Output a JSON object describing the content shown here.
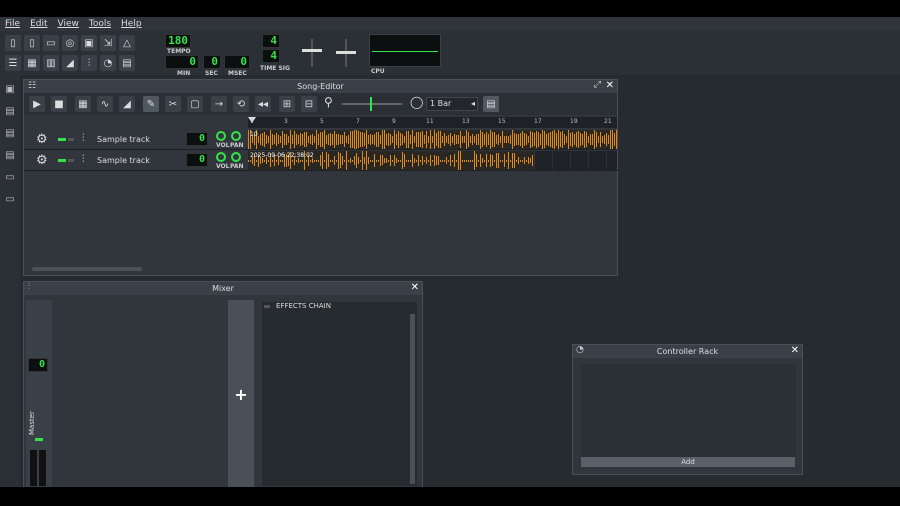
{
  "menu": [
    "File",
    "Edit",
    "View",
    "Tools",
    "Help"
  ],
  "toolbar": {
    "tempo_value": "180",
    "tempo_label": "TEMPO",
    "min_value": "0",
    "min_label": "MIN",
    "sec_value": "0",
    "sec_label": "SEC",
    "msec_value": "0",
    "msec_label": "MSEC",
    "timesig_num": "4",
    "timesig_den": "4",
    "timesig_label": "TIME SIG",
    "cpu_label": "CPU",
    "icons_row1": [
      "new-project-icon",
      "new-from-template-icon",
      "open-project-icon",
      "recent-projects-icon",
      "save-icon",
      "export-icon",
      "metronome-icon"
    ],
    "icons_row2": [
      "song-editor-icon",
      "beat-bassline-icon",
      "piano-roll-icon",
      "automation-editor-icon",
      "mixer-icon",
      "controller-rack-icon",
      "project-notes-icon"
    ]
  },
  "song_editor": {
    "title": "Song-Editor",
    "snap_value": "1 Bar",
    "ruler_ticks": [
      "1",
      "3",
      "5",
      "7",
      "9",
      "11",
      "13",
      "15",
      "17",
      "19",
      "21"
    ],
    "tracks": [
      {
        "name": "Sample track",
        "volume": "0",
        "vol_label": "VOL",
        "pan_label": "PAN",
        "clip_label": "10"
      },
      {
        "name": "Sample track",
        "volume": "0",
        "vol_label": "VOL",
        "pan_label": "PAN",
        "clip_label": "2025-09-06 22:38:02"
      }
    ]
  },
  "mixer": {
    "title": "Mixer",
    "master_label": "Master",
    "master_value": "0",
    "effects_chain_label": "EFFECTS CHAIN",
    "add_channel_symbol": "+"
  },
  "controller_rack": {
    "title": "Controller Rack",
    "add_label": "Add"
  },
  "colors": {
    "lcd_green": "#35e24a",
    "wave_orange": "#e08a1e",
    "background": "#262b30"
  }
}
